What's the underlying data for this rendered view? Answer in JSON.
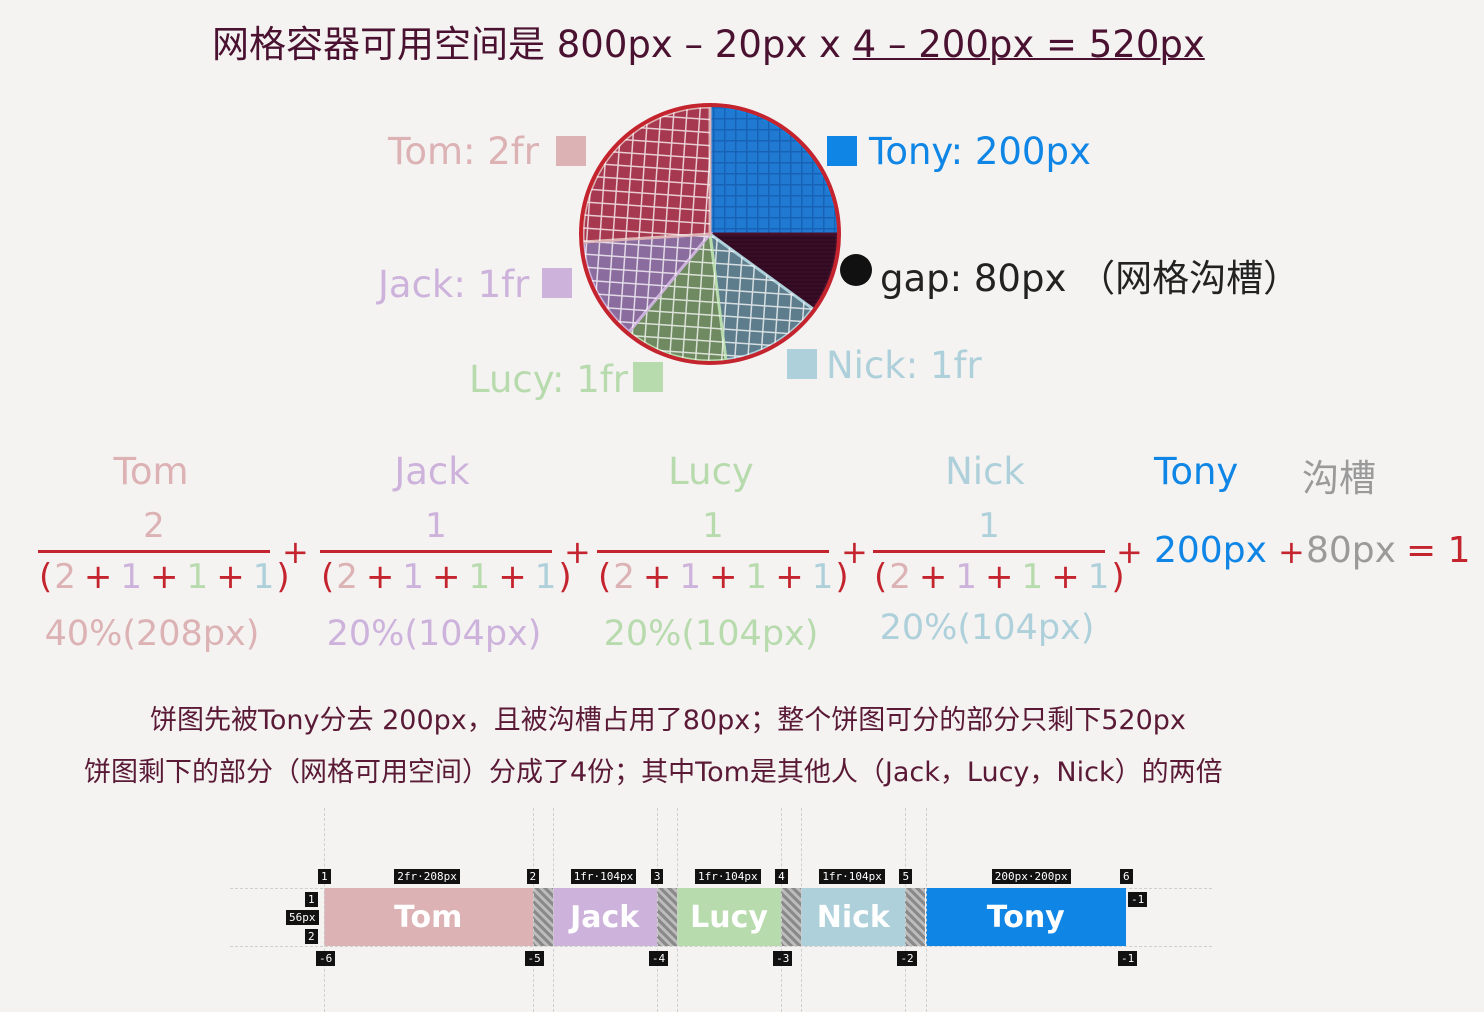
{
  "title": {
    "prefix": "网格容器可用空间是 800px – 20px x ",
    "underlined": "4 – 200px = 520px"
  },
  "legend": {
    "tom": "Tom: 2fr",
    "tony": "Tony: 200px",
    "gap": "gap: 80px （网格沟槽）",
    "jack": "Jack: 1fr",
    "lucy": "Lucy: 1fr",
    "nick": "Nick: 1fr"
  },
  "colors": {
    "tom": "#dcb2b4",
    "jack": "#cdb3dc",
    "lucy": "#b8dbae",
    "nick": "#aed0da",
    "tony": "#0f86e6",
    "gap": "#4a1230",
    "red": "#c4242e"
  },
  "chart_data": {
    "type": "pie",
    "slices": [
      {
        "name": "Tony",
        "value": 200
      },
      {
        "name": "gap",
        "value": 80
      },
      {
        "name": "Nick",
        "value": 104
      },
      {
        "name": "Lucy",
        "value": 104
      },
      {
        "name": "Jack",
        "value": 104
      },
      {
        "name": "Tom",
        "value": 208
      }
    ]
  },
  "formula": {
    "columns": [
      {
        "name": "Tom",
        "num": "2",
        "pct": "40%(208px)"
      },
      {
        "name": "Jack",
        "num": "1",
        "pct": "20%(104px)"
      },
      {
        "name": "Lucy",
        "num": "1",
        "pct": "20%(104px)"
      },
      {
        "name": "Nick",
        "num": "1",
        "pct": "20%(104px)"
      }
    ],
    "denominator": [
      "(",
      "2",
      "+",
      "1",
      "+",
      "1",
      "+",
      "1",
      ")"
    ],
    "tony_header": "Tony",
    "gap_header": "沟槽",
    "plus": "+",
    "tony_value": "200px",
    "gap_value": "80px",
    "equals": "= 1"
  },
  "description": {
    "line1": "饼图先被Tony分去 200px，且被沟槽占用了80px；整个饼图可分的部分只剩下520px",
    "line2": "饼图剩下的部分（网格可用空间）分成了4份；其中Tom是其他人（Jack，Lucy，Nick）的两倍"
  },
  "grid": {
    "cells": [
      "Tom",
      "Jack",
      "Lucy",
      "Nick",
      "Tony"
    ],
    "track_tags": [
      "2fr·208px",
      "1fr·104px",
      "1fr·104px",
      "1fr·104px",
      "200px·200px"
    ],
    "top_numbers": [
      "1",
      "2",
      "3",
      "4",
      "5",
      "6"
    ],
    "bottom_numbers": [
      "-6",
      "-5",
      "-4",
      "-3",
      "-2",
      "-1"
    ],
    "row_top": "1",
    "row_bottom": "2",
    "row_right_top": "-1",
    "row_right_bottom": "-1",
    "row_size": "56px"
  }
}
